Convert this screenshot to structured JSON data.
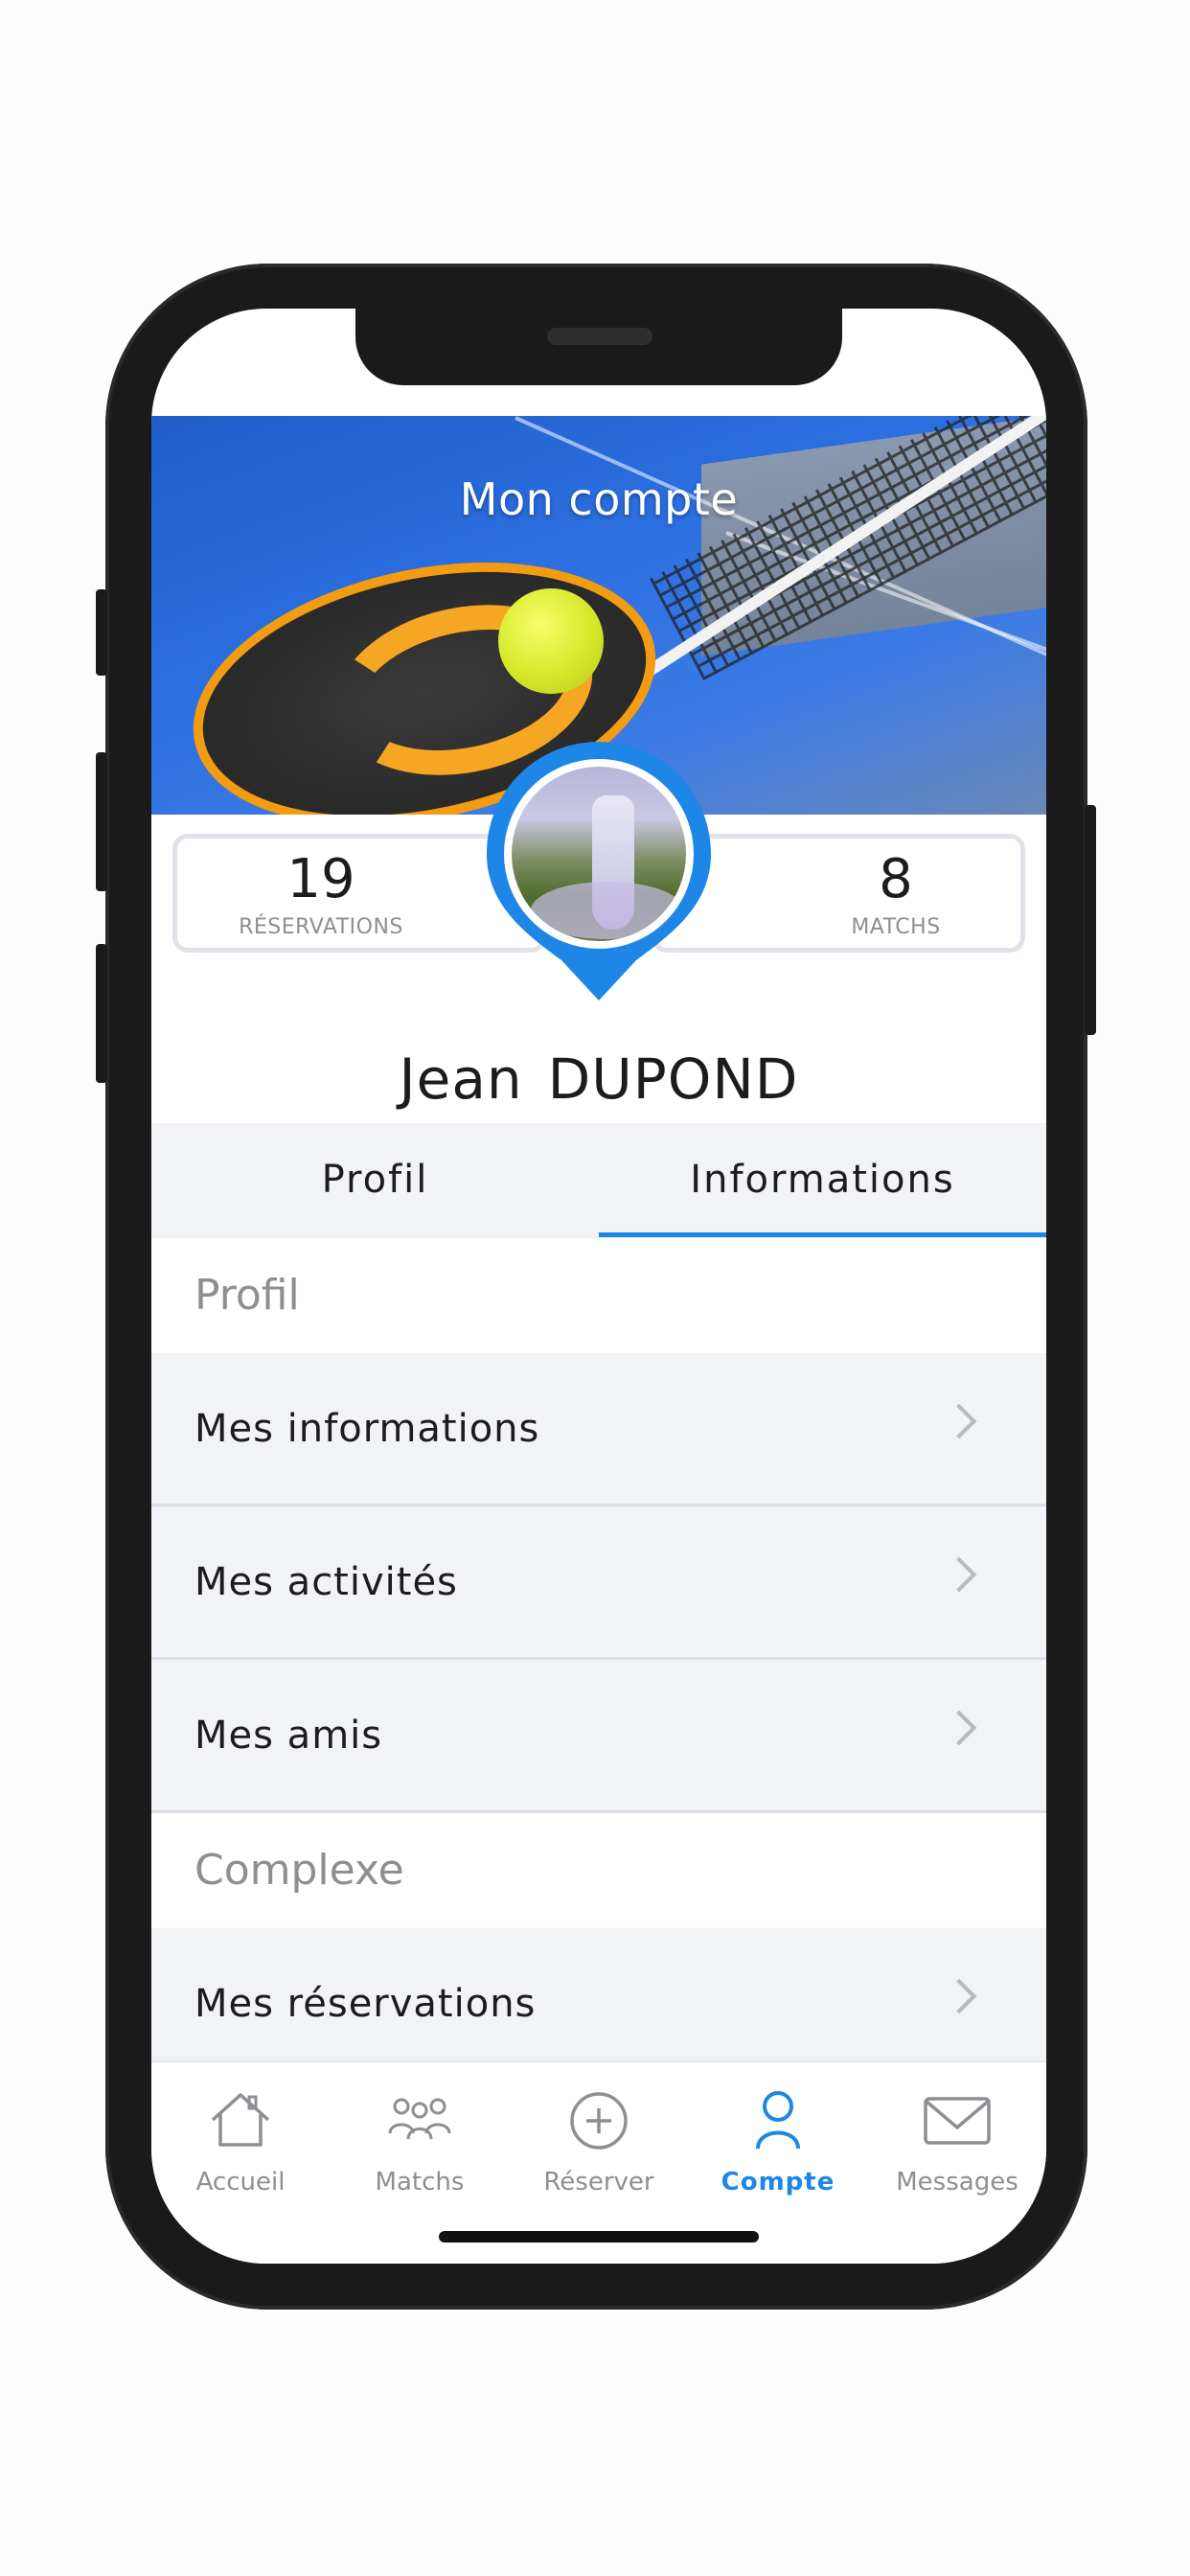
{
  "header": {
    "title": "Mon compte"
  },
  "stats": {
    "reservations": {
      "value": "19",
      "label": "RÉSERVATIONS"
    },
    "matchs": {
      "value": "8",
      "label": "MATCHS"
    }
  },
  "user": {
    "first_name": "Jean",
    "last_name": "DUPOND"
  },
  "tabs": [
    {
      "label": "Profil",
      "active": false
    },
    {
      "label": "Informations",
      "active": true
    }
  ],
  "sections": [
    {
      "title": "Profil",
      "items": [
        {
          "label": "Mes informations"
        },
        {
          "label": "Mes activités"
        },
        {
          "label": "Mes amis"
        }
      ]
    },
    {
      "title": "Complexe",
      "items": [
        {
          "label": "Mes réservations"
        }
      ]
    }
  ],
  "tabbar": [
    {
      "label": "Accueil",
      "icon": "home-icon",
      "active": false
    },
    {
      "label": "Matchs",
      "icon": "people-icon",
      "active": false
    },
    {
      "label": "Réserver",
      "icon": "plus-circle-icon",
      "active": false
    },
    {
      "label": "Compte",
      "icon": "user-icon",
      "active": true
    },
    {
      "label": "Messages",
      "icon": "mail-icon",
      "active": false
    }
  ],
  "colors": {
    "accent": "#1e86e6",
    "list_bg": "#f2f3f7",
    "muted_text": "#8e8e93"
  }
}
